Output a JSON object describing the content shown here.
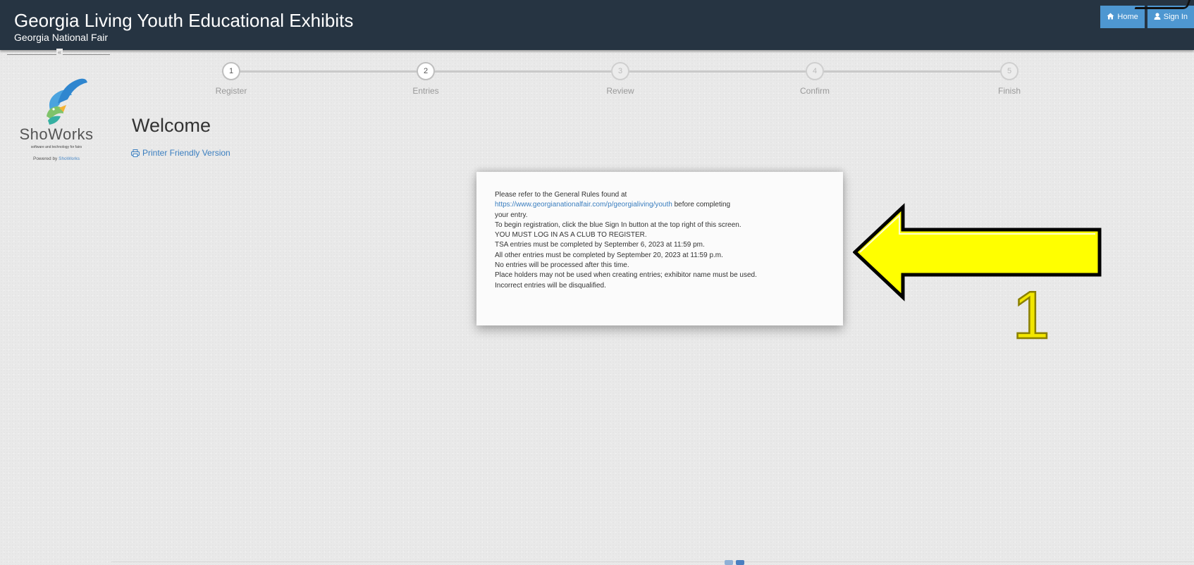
{
  "header": {
    "title": "Georgia Living Youth Educational Exhibits",
    "subtitle": "Georgia National Fair",
    "nav": {
      "home_label": "Home",
      "signin_label": "Sign In"
    }
  },
  "sidebar": {
    "collapse_glyph": "«",
    "brand": "ShoWorks",
    "tagline": "software and technology for fairs",
    "powered_prefix": "Powered by ",
    "powered_link": "ShoWorks"
  },
  "steps": [
    {
      "number": "1",
      "label": "Register",
      "state": "active"
    },
    {
      "number": "2",
      "label": "Entries",
      "state": "active"
    },
    {
      "number": "3",
      "label": "Review",
      "state": "inactive"
    },
    {
      "number": "4",
      "label": "Confirm",
      "state": "inactive"
    },
    {
      "number": "5",
      "label": "Finish",
      "state": "inactive"
    }
  ],
  "main": {
    "heading": "Welcome",
    "printer_link": "Printer Friendly Version"
  },
  "notice": {
    "line1": "Please refer to the General Rules found at",
    "link": "https://www.georgianationalfair.com/p/georgialiving/youth",
    "line2_suffix": "  before  completing",
    "line3": " your entry.",
    "line4": "To begin registration, click the blue Sign In button at the top right of this screen.",
    "line5": "YOU MUST LOG IN AS A CLUB TO REGISTER.",
    "line6": "TSA entries must be completed by September 6, 2023 at 11:59 pm.",
    "line7": "All other entries must be completed by September 20, 2023 at 11:59 p.m.",
    "line8": "No entries will be processed after this time.",
    "line9": "Place holders may not be used when creating entries; exhibitor name must be used.",
    "line10": "Incorrect entries will be disqualified."
  },
  "annotation": {
    "number": "1",
    "arrow_color": "#ffff00",
    "number_color": "#f2e600"
  },
  "colors": {
    "header_bg": "#263442",
    "nav_button": "#4e97d1",
    "link": "#3a7ebf"
  }
}
